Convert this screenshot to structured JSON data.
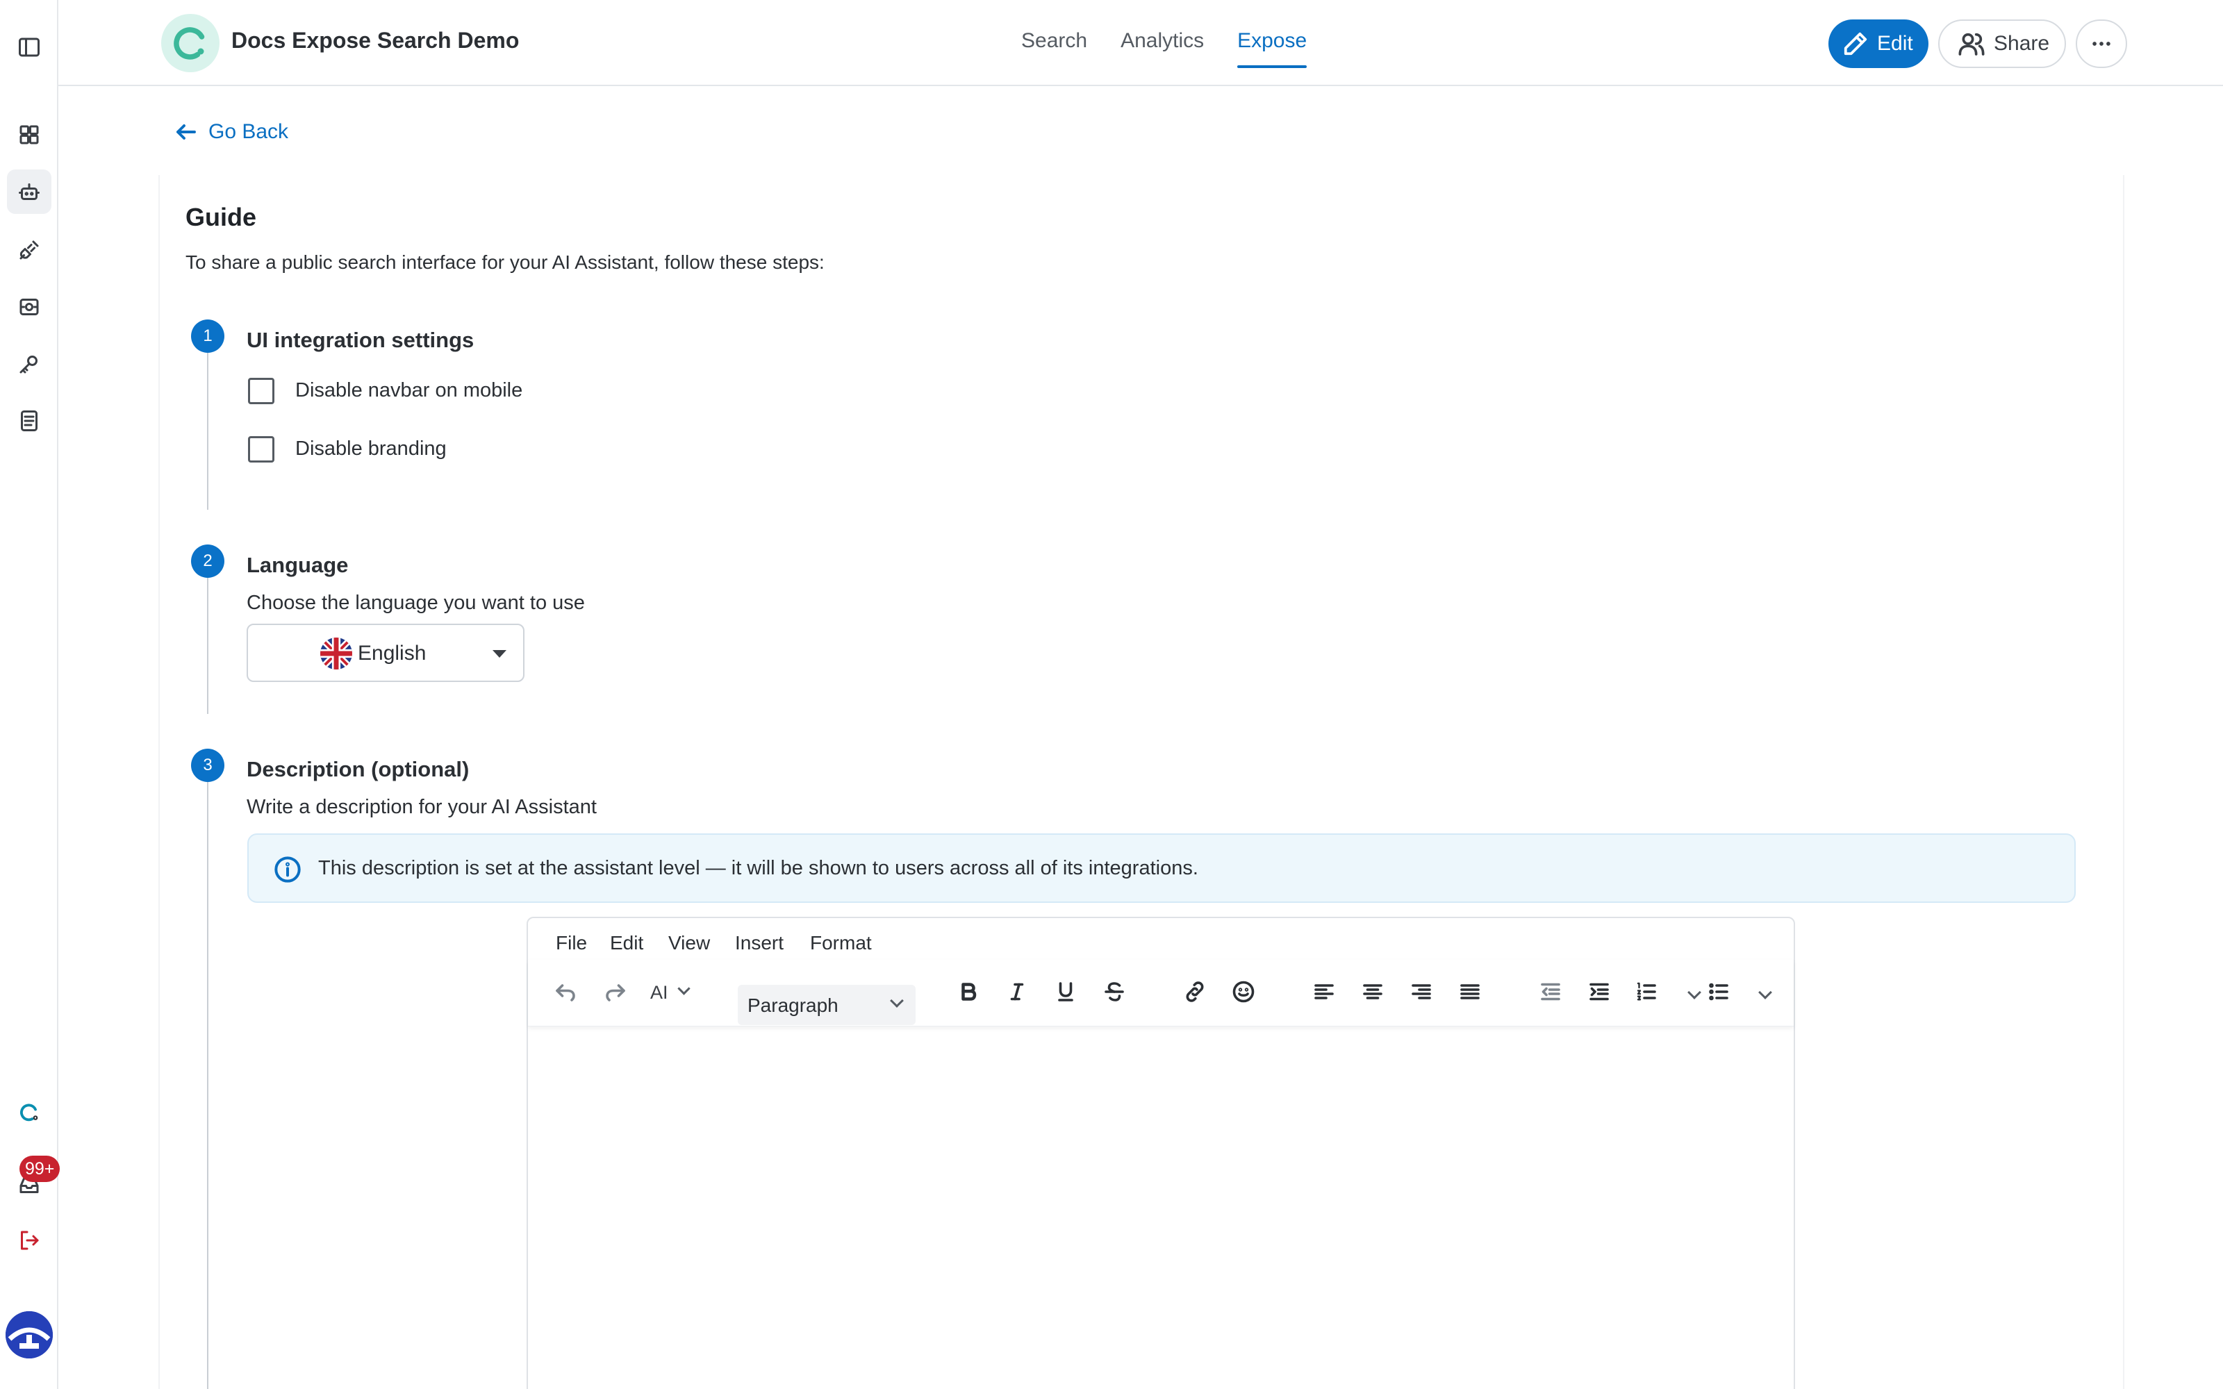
{
  "app": {
    "title": "Docs Expose Search Demo",
    "accent_color": "#0a72c8"
  },
  "sidebar": {
    "items": [
      {
        "icon": "panel-toggle-icon"
      },
      {
        "icon": "grid-icon"
      },
      {
        "icon": "bot-icon",
        "active": true
      },
      {
        "icon": "plug-icon"
      },
      {
        "icon": "scan-icon"
      },
      {
        "icon": "key-icon"
      },
      {
        "icon": "document-icon"
      }
    ],
    "notifications_badge": "99+"
  },
  "header": {
    "tabs": [
      {
        "label": "Search"
      },
      {
        "label": "Analytics"
      },
      {
        "label": "Expose",
        "active": true
      }
    ],
    "edit_label": "Edit",
    "share_label": "Share"
  },
  "page": {
    "back_label": "Go Back",
    "guide_title": "Guide",
    "guide_description": "To share a public search interface for your AI Assistant, follow these steps:"
  },
  "steps": [
    {
      "number": "1",
      "title": "UI integration settings",
      "options": [
        {
          "label": "Disable navbar on mobile",
          "checked": false
        },
        {
          "label": "Disable branding",
          "checked": false
        }
      ]
    },
    {
      "number": "2",
      "title": "Language",
      "subtitle": "Choose the language you want to use",
      "selected_language": "English"
    },
    {
      "number": "3",
      "title": "Description (optional)",
      "subtitle": "Write a description for your AI Assistant",
      "info": "This description is set at the assistant level — it will be shown to users across all of its integrations."
    }
  ],
  "editor": {
    "menu": [
      "File",
      "Edit",
      "View",
      "Insert",
      "Format"
    ],
    "ai_label": "AI",
    "block_format": "Paragraph"
  }
}
